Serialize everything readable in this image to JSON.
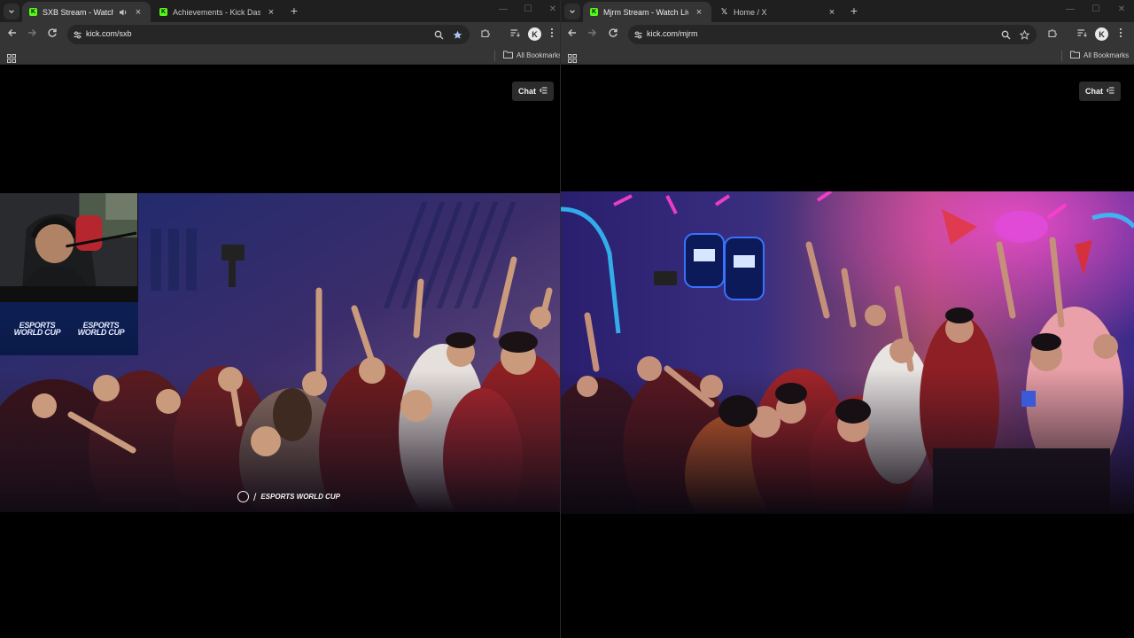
{
  "left_window": {
    "tabs": [
      {
        "title": "SXB Stream - Watch Live on Kick",
        "favicon": "kick-logo-icon",
        "audio": true,
        "active": true
      },
      {
        "title": "Achievements - Kick Dashboard",
        "favicon": "kick-logo-icon",
        "audio": false,
        "active": false
      }
    ],
    "address": "kick.com/sxb",
    "bookmarks_label": "All Bookmarks",
    "chat_label": "Chat",
    "video": {
      "banner_logo_1": "ESPORTS WORLD CUP",
      "banner_logo_2": "ESPORTS WORLD CUP",
      "watermark": "ESPORTS WORLD CUP"
    }
  },
  "right_window": {
    "tabs": [
      {
        "title": "Mjrm Stream - Watch Live on Kick",
        "favicon": "kick-logo-icon",
        "audio": false,
        "active": true
      },
      {
        "title": "Home / X",
        "favicon": "x-logo-icon",
        "audio": false,
        "active": false
      }
    ],
    "address": "kick.com/mjrm",
    "bookmarks_label": "All Bookmarks",
    "chat_label": "Chat"
  },
  "colors": {
    "tab_strip": "#1f1f1f",
    "toolbar": "#353535",
    "omnibox": "#262626",
    "kick_green": "#53fc18",
    "page_background": "#000000"
  }
}
